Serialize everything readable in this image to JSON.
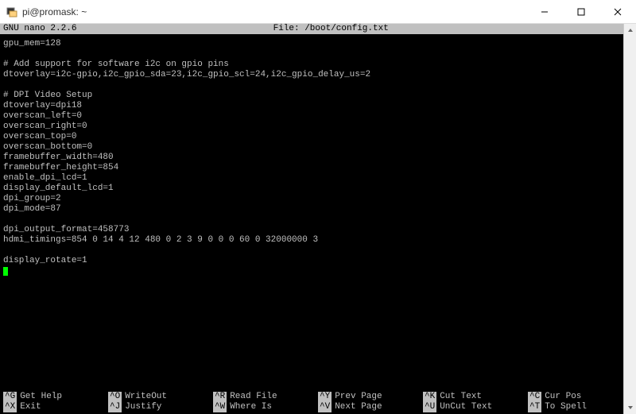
{
  "window": {
    "title": "pi@promask: ~"
  },
  "nano": {
    "version": "GNU nano 2.2.6",
    "file_label": "File: /boot/config.txt",
    "content": "gpu_mem=128\n\n# Add support for software i2c on gpio pins\ndtoverlay=i2c-gpio,i2c_gpio_sda=23,i2c_gpio_scl=24,i2c_gpio_delay_us=2\n\n# DPI Video Setup\ndtoverlay=dpi18\noverscan_left=0\noverscan_right=0\noverscan_top=0\noverscan_bottom=0\nframebuffer_width=480\nframebuffer_height=854\nenable_dpi_lcd=1\ndisplay_default_lcd=1\ndpi_group=2\ndpi_mode=87\n\ndpi_output_format=458773\nhdmi_timings=854 0 14 4 12 480 0 2 3 9 0 0 0 60 0 32000000 3\n\ndisplay_rotate=1"
  },
  "shortcuts": {
    "row1": [
      {
        "key": "^G",
        "label": "Get Help"
      },
      {
        "key": "^O",
        "label": "WriteOut"
      },
      {
        "key": "^R",
        "label": "Read File"
      },
      {
        "key": "^Y",
        "label": "Prev Page"
      },
      {
        "key": "^K",
        "label": "Cut Text"
      },
      {
        "key": "^C",
        "label": "Cur Pos"
      }
    ],
    "row2": [
      {
        "key": "^X",
        "label": "Exit"
      },
      {
        "key": "^J",
        "label": "Justify"
      },
      {
        "key": "^W",
        "label": "Where Is"
      },
      {
        "key": "^V",
        "label": "Next Page"
      },
      {
        "key": "^U",
        "label": "UnCut Text"
      },
      {
        "key": "^T",
        "label": "To Spell"
      }
    ]
  }
}
